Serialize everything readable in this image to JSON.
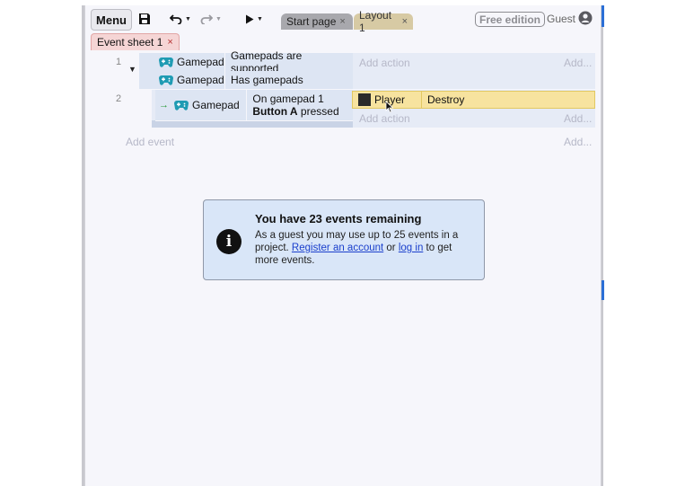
{
  "toolbar": {
    "menu_label": "Menu",
    "tabs": [
      {
        "label": "Start page",
        "close": "×"
      },
      {
        "label": "Layout 1",
        "close": "×"
      }
    ],
    "free_edition_label": "Free edition",
    "user_label": "Guest",
    "icons": [
      "save-icon",
      "undo-icon",
      "redo-icon",
      "play-icon",
      "user-icon"
    ]
  },
  "sheet_tab": {
    "label": "Event sheet 1",
    "close": "×"
  },
  "events": [
    {
      "number": "1",
      "conditions": [
        {
          "object": "Gamepad",
          "text": "Gamepads are supported"
        },
        {
          "object": "Gamepad",
          "text": "Has gamepads"
        }
      ],
      "add_action": "Add action",
      "add_more": "Add..."
    },
    {
      "number": "2",
      "conditions": [
        {
          "object": "Gamepad",
          "text_prefix": "On gamepad 1 ",
          "text_bold": "Button A",
          "text_suffix": " pressed"
        }
      ],
      "action": {
        "object": "Player",
        "text": "Destroy"
      },
      "add_action": "Add action",
      "add_more": "Add..."
    }
  ],
  "add_event": "Add event",
  "add_event_more": "Add...",
  "notice": {
    "title": "You have 23 events remaining",
    "text_1": "As a guest you may use up to 25 events in a project. ",
    "link_register": "Register an account",
    "text_2": " or ",
    "link_login": "log in",
    "text_3": " to get more events."
  },
  "colors": {
    "accent_blue": "#2b6fd6",
    "condition_bg": "#dde5f3",
    "action_highlight": "#f7e39f",
    "sheet_tab_bg": "#f5d5d5",
    "notice_bg": "#d9e6f8",
    "gamepad_icon": "#1f9bb3"
  }
}
